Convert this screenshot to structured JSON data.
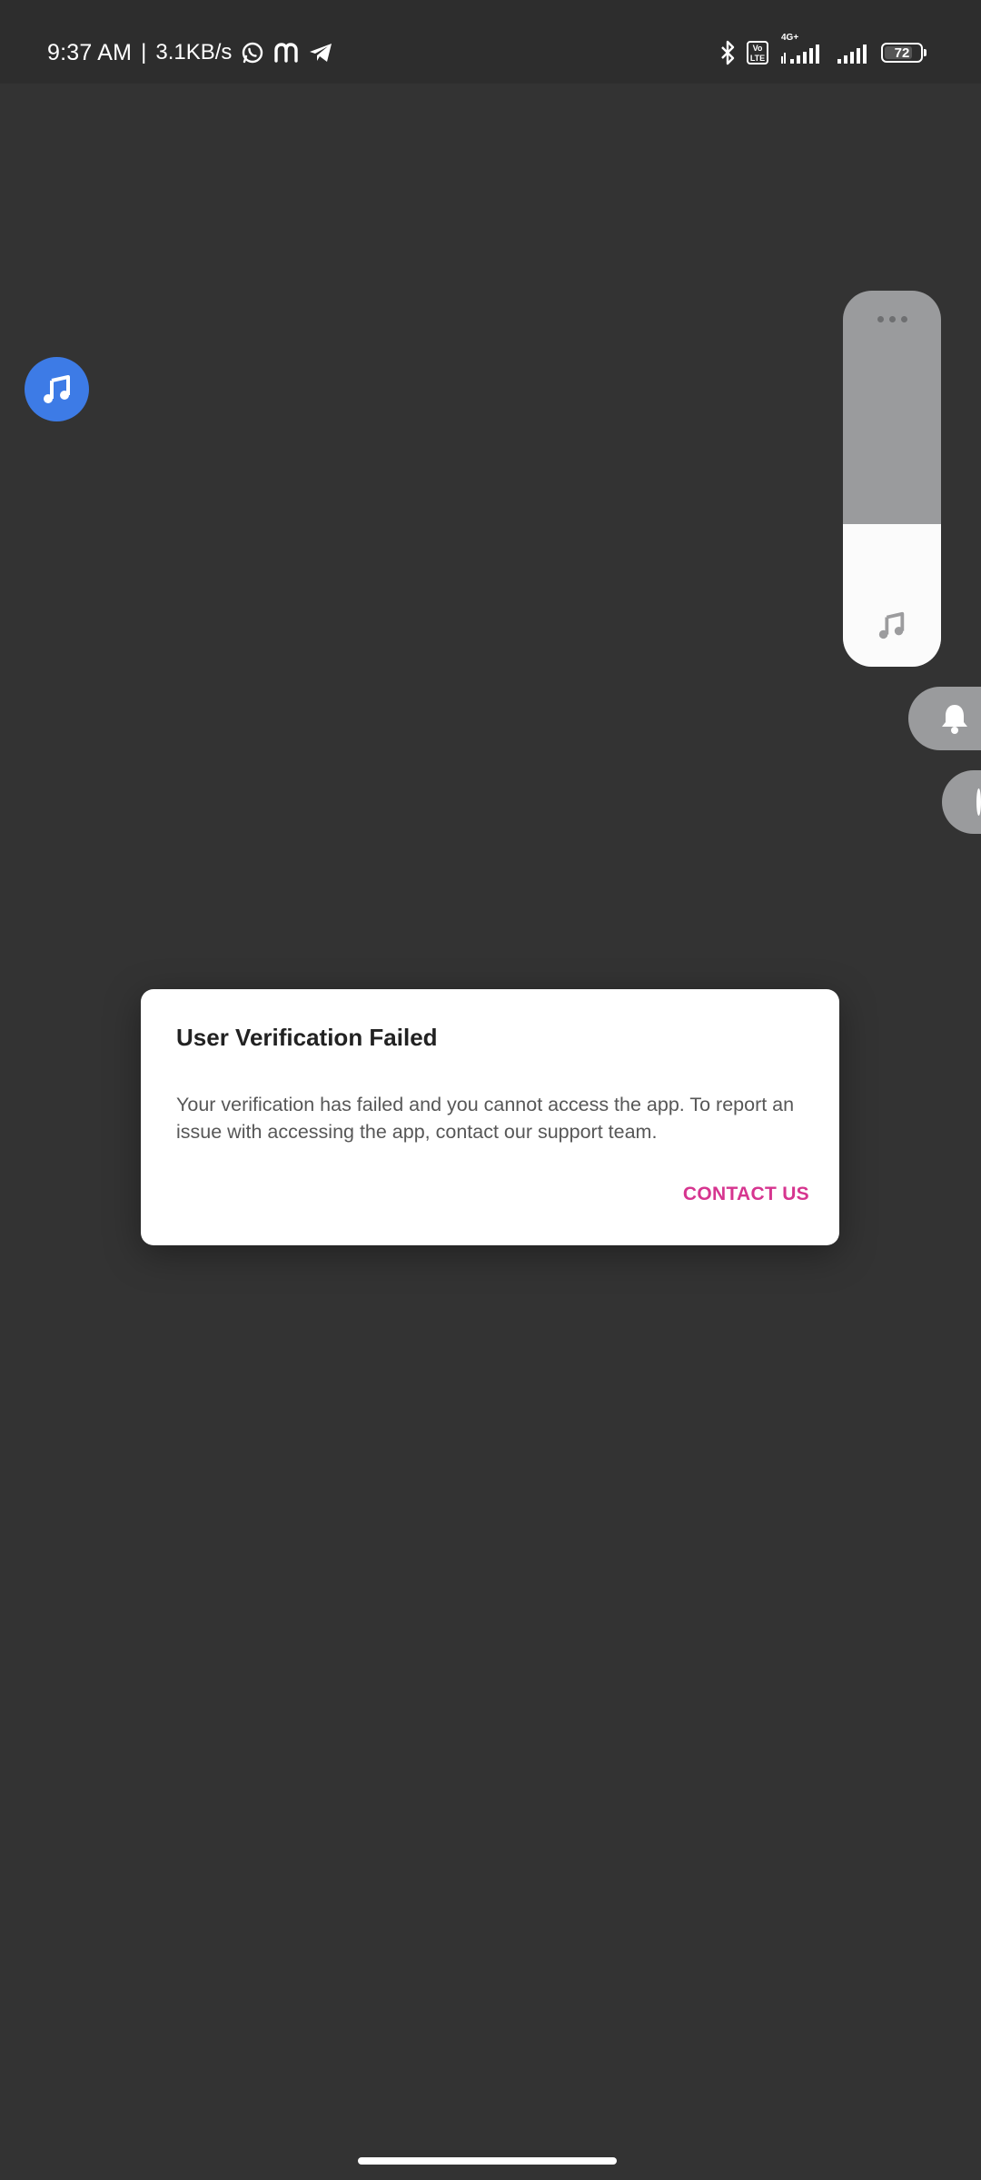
{
  "status_bar": {
    "time": "9:37 AM",
    "separator": "|",
    "network_speed": "3.1KB/s",
    "notification_icons": [
      "whatsapp-icon",
      "m-app-icon",
      "telegram-icon"
    ],
    "right_icons": [
      "bluetooth-icon",
      "volte-icon",
      "signal-4g-icon",
      "signal-icon",
      "battery-icon"
    ],
    "volte_label": "Vo LTE",
    "network_type": "4G+",
    "battery_level": "72"
  },
  "floating_bubble": {
    "icon": "music-note-icon",
    "color": "#3d7be6"
  },
  "volume_panel": {
    "level_fraction": 0.27,
    "icon": "music-note-icon",
    "more_icon": "more-dots-icon",
    "side_buttons": [
      "bell-icon",
      "mode-icon"
    ]
  },
  "dialog": {
    "title": "User Verification Failed",
    "message": "Your verification has failed and you cannot access the app. To report an issue with accessing the app, contact our support team.",
    "action_label": "CONTACT US",
    "accent_color": "#d6358f"
  }
}
